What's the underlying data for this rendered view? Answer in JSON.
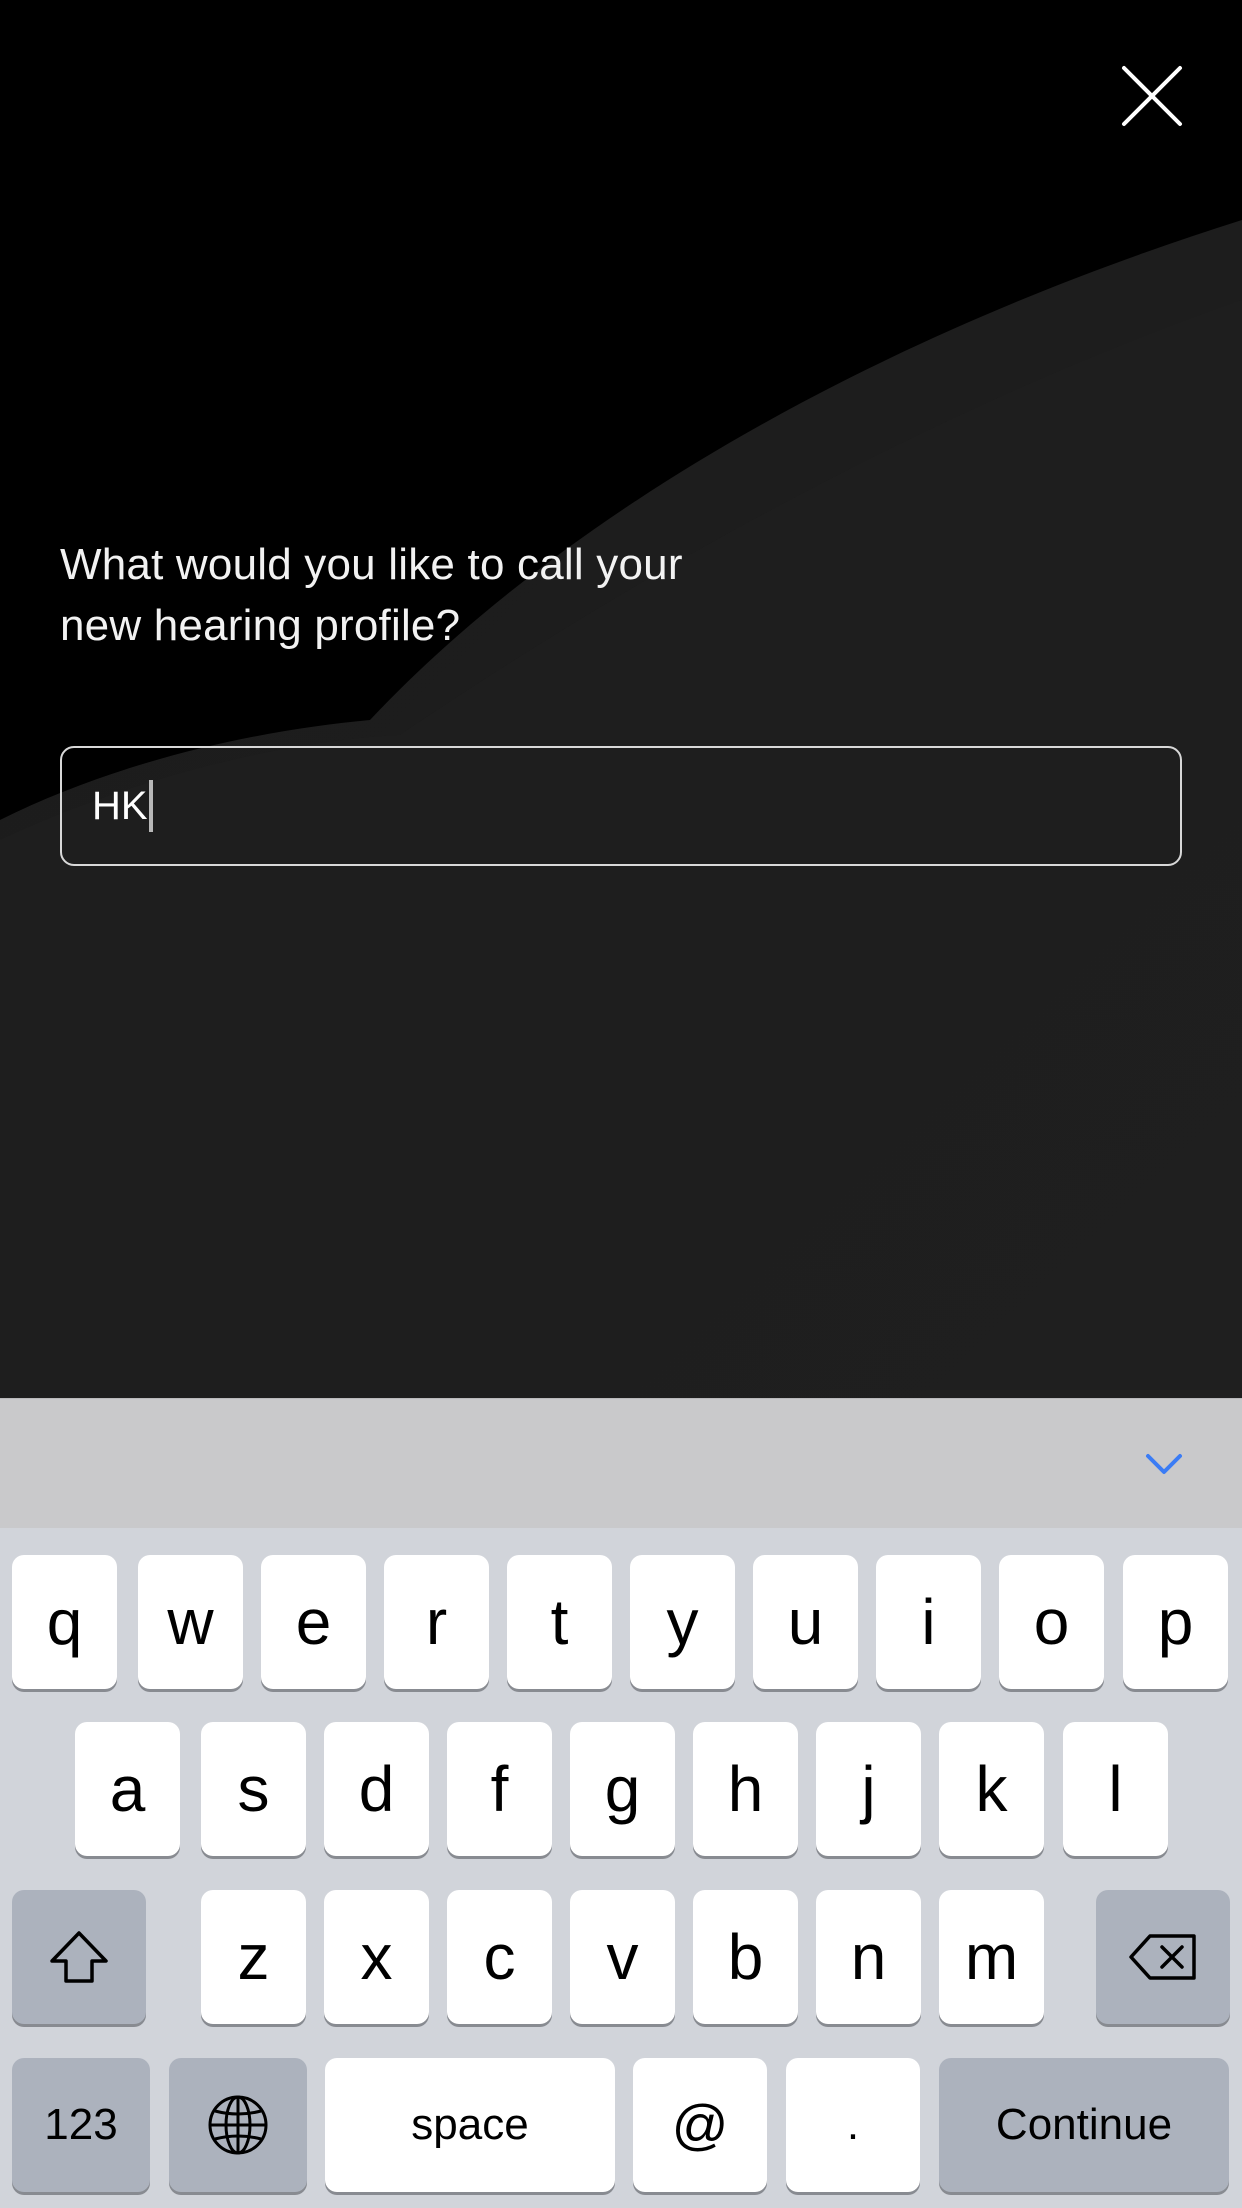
{
  "prompt": {
    "line1": "What would you like to call your",
    "line2": "new hearing profile?"
  },
  "profile_name": {
    "value": "HK"
  },
  "icons": {
    "close": "close-icon",
    "keyboard_dismiss": "chevron-down-icon",
    "shift": "shift-icon",
    "backspace": "backspace-icon",
    "globe": "globe-icon"
  },
  "colors": {
    "background": "#000000",
    "accent_blue": "#3b7cf5",
    "keyboard_bg": "#d1d4da"
  },
  "keyboard": {
    "row1": [
      "q",
      "w",
      "e",
      "r",
      "t",
      "y",
      "u",
      "i",
      "o",
      "p"
    ],
    "row2": [
      "a",
      "s",
      "d",
      "f",
      "g",
      "h",
      "j",
      "k",
      "l"
    ],
    "row3": [
      "z",
      "x",
      "c",
      "v",
      "b",
      "n",
      "m"
    ],
    "numbers_label": "123",
    "space_label": "space",
    "at_label": "@",
    "period_label": ".",
    "return_label": "Continue"
  }
}
